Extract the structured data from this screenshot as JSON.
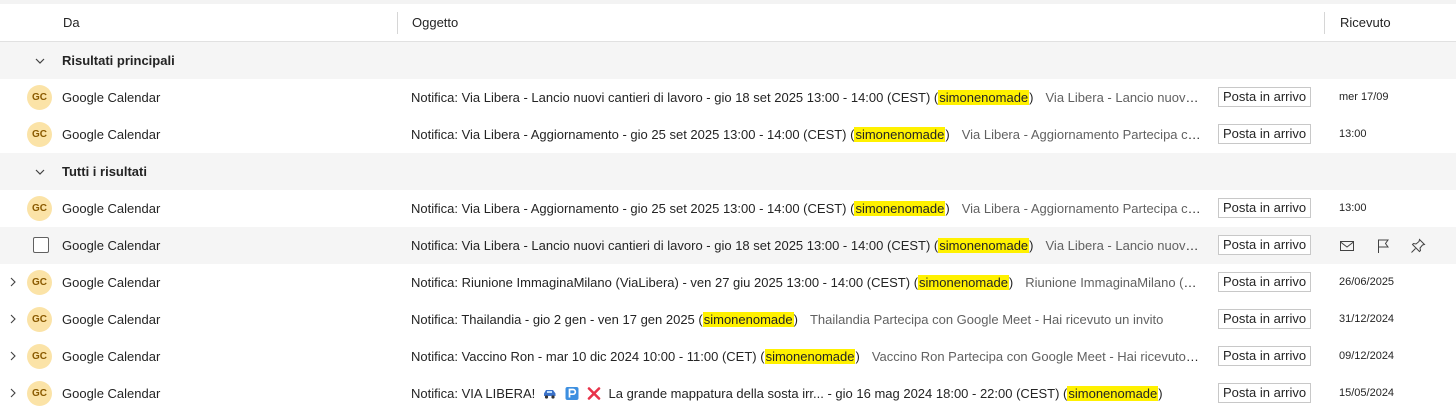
{
  "columns": {
    "from": "Da",
    "subject": "Oggetto",
    "received": "Ricevuto"
  },
  "groups": {
    "top": "Risultati principali",
    "all": "Tutti i risultati"
  },
  "highlight_color": "#fff100",
  "avatar_color": "#fbe3a7",
  "rows": [
    {
      "avatar": "GC",
      "sender": "Google Calendar",
      "subject_pre": "Notifica: Via Libera - Lancio nuovi cantieri di lavoro - gio 18 set 2025 13:00 - 14:00 (CEST) (",
      "highlight": "simonenomade",
      "subject_post": ")",
      "preview": "Via Libera - Lancio nuovi cantieri di lavoro",
      "folder": "Posta in arrivo",
      "date": "mer 17/09"
    },
    {
      "avatar": "GC",
      "sender": "Google Calendar",
      "subject_pre": "Notifica: Via Libera - Aggiornamento - gio 25 set 2025 13:00 - 14:00 (CEST) (",
      "highlight": "simonenomade",
      "subject_post": ")",
      "preview": "Via Libera - Aggiornamento Partecipa con Google Meet",
      "folder": "Posta in arrivo",
      "date": "13:00"
    },
    {
      "avatar": "GC",
      "sender": "Google Calendar",
      "subject_pre": "Notifica: Via Libera - Aggiornamento - gio 25 set 2025 13:00 - 14:00 (CEST) (",
      "highlight": "simonenomade",
      "subject_post": ")",
      "preview": "Via Libera - Aggiornamento Partecipa con Google Meet",
      "folder": "Posta in arrivo",
      "date": "13:00"
    },
    {
      "avatar": "",
      "sender": "Google Calendar",
      "subject_pre": "Notifica: Via Libera - Lancio nuovi cantieri di lavoro - gio 18 set 2025 13:00 - 14:00 (CEST) (",
      "highlight": "simonenomade",
      "subject_post": ")",
      "preview": "Via Libera - Lancio nuovi cantieri di lavoro",
      "folder": "Posta in arrivo",
      "date": "",
      "actions": [
        "mail-icon",
        "flag-icon",
        "pin-icon"
      ]
    },
    {
      "avatar": "GC",
      "sender": "Google Calendar",
      "subject_pre": "Notifica: Riunione ImmaginaMilano (ViaLibera) - ven 27 giu 2025 13:00 - 14:00 (CEST) (",
      "highlight": "simonenomade",
      "subject_post": ")",
      "preview": "Riunione ImmaginaMilano (ViaLibera)",
      "folder": "Posta in arrivo",
      "date": "26/06/2025"
    },
    {
      "avatar": "GC",
      "sender": "Google Calendar",
      "subject_pre": "Notifica: Thailandia - gio 2 gen - ven 17 gen 2025 (",
      "highlight": "simonenomade",
      "subject_post": ")",
      "preview": "Thailandia Partecipa con Google Meet - Hai ricevuto un invito",
      "folder": "Posta in arrivo",
      "date": "31/12/2024"
    },
    {
      "avatar": "GC",
      "sender": "Google Calendar",
      "subject_pre": "Notifica: Vaccino Ron - mar 10 dic 2024 10:00 - 11:00 (CET) (",
      "highlight": "simonenomade",
      "subject_post": ")",
      "preview": "Vaccino Ron Partecipa con Google Meet - Hai ricevuto un invito",
      "folder": "Posta in arrivo",
      "date": "09/12/2024"
    },
    {
      "avatar": "GC",
      "sender": "Google Calendar",
      "subject_pre": "Notifica: VIA LIBERA! ",
      "subject_mid": " La grande mappatura della sosta irr... - gio 16 mag 2024 18:00 - 22:00 (CEST) (",
      "highlight": "simonenomade",
      "subject_post": ")",
      "preview": "",
      "folder": "Posta in arrivo",
      "date": "15/05/2024"
    }
  ]
}
